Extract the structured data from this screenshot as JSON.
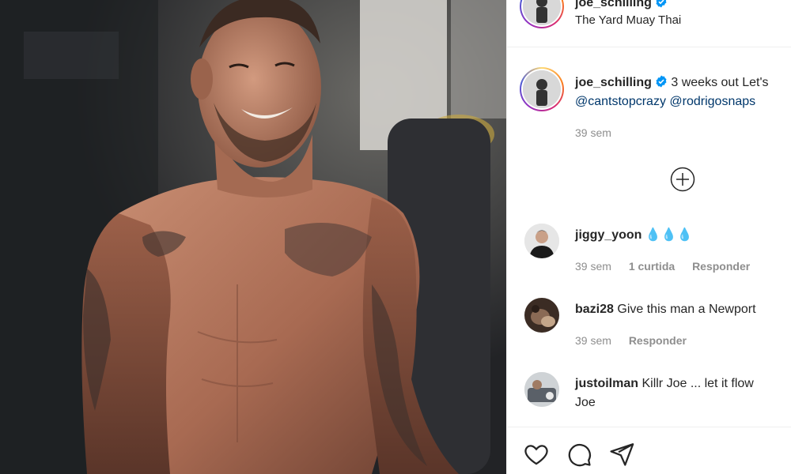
{
  "post": {
    "header": {
      "username": "joe_schilling",
      "location": "The Yard Muay Thai"
    },
    "caption": {
      "username": "joe_schilling",
      "text": "3 weeks out Let's",
      "mentions": [
        "@cantstopcrazy",
        "@rodrigosnaps"
      ],
      "time": "39 sem"
    },
    "load_more_icon": "plus-circle-icon",
    "comments": [
      {
        "username": "jiggy_yoon",
        "text": "💧💧💧",
        "time": "39 sem",
        "likes": "1 curtida",
        "reply": "Responder"
      },
      {
        "username": "bazi28",
        "text": "Give this man a Newport",
        "time": "39 sem",
        "reply": "Responder"
      },
      {
        "username": "justoilman",
        "text": "Killr Joe ... let it flow",
        "text_line2": "Joe"
      }
    ],
    "actions": [
      "heart-icon",
      "comment-icon",
      "share-icon"
    ],
    "colors": {
      "text": "#262626",
      "muted": "#8e8e8e",
      "mention": "#00376b",
      "verified": "#0095f6",
      "border": "#efefef"
    }
  }
}
